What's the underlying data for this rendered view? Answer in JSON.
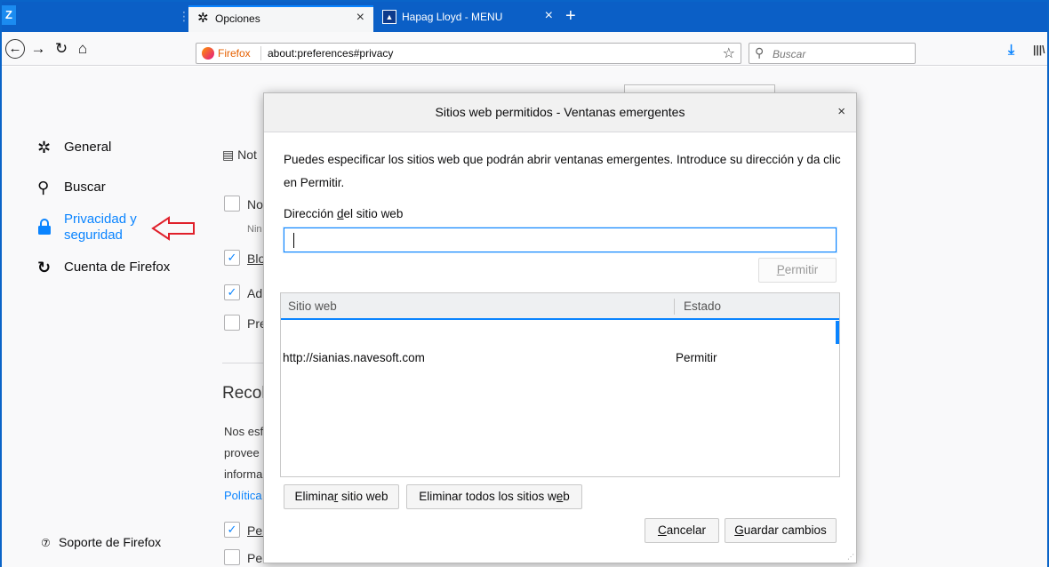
{
  "browser": {
    "tabs": [
      {
        "title": "Opciones",
        "icon": "gear-icon",
        "active": true,
        "close": "×"
      },
      {
        "title": "Hapag Lloyd - MENU",
        "icon": "hapag-lloyd-favicon",
        "active": false,
        "close": "×"
      }
    ],
    "new_tab": "+",
    "app_badge": "Z",
    "url_identity": "Firefox",
    "url": "about:preferences#privacy",
    "search_placeholder": "Buscar"
  },
  "sidebar": {
    "items": [
      {
        "label": "General",
        "icon": "gear-icon"
      },
      {
        "label": "Buscar",
        "icon": "search-icon"
      },
      {
        "label": "Privacidad y seguridad",
        "icon": "lock-icon",
        "selected": true
      },
      {
        "label": "Cuenta de Firefox",
        "icon": "sync-icon"
      }
    ],
    "support": "Soporte de Firefox"
  },
  "background": {
    "notif_prefix": "Not",
    "rows": [
      "No",
      "Nin",
      "Blo",
      "Ad",
      "Pre"
    ],
    "heading": "Recol",
    "para": [
      "Nos esf",
      "provee",
      "informa",
      "Política"
    ],
    "bottom_rows": [
      "Per",
      "Per"
    ]
  },
  "dialog": {
    "title": "Sitios web permitidos - Ventanas emergentes",
    "close": "×",
    "description": "Puedes especificar los sitios web que podrán abrir ventanas emergentes. Introduce su dirección y da clic en Permitir.",
    "address_label_pre": "Dirección ",
    "address_label_ul": "d",
    "address_label_post": "el sitio web",
    "address_value": "",
    "permit_button_ul": "P",
    "permit_button_rest": "ermitir",
    "table": {
      "headers": [
        "Sitio web",
        "Estado"
      ],
      "rows": [
        {
          "site": "http://sianias.navesoft.com",
          "status": "Permitir"
        }
      ]
    },
    "remove_site_pre": "Elimina",
    "remove_site_ul": "r",
    "remove_site_post": " sitio web",
    "remove_all_pre": "Eliminar todos los sitios w",
    "remove_all_ul": "e",
    "remove_all_post": "b",
    "cancel_ul": "C",
    "cancel_rest": "ancelar",
    "save_ul": "G",
    "save_rest": "uardar cambios"
  },
  "colors": {
    "tabbar": "#0b5fc6",
    "accent": "#0a84ff",
    "arrow": "#e0202a"
  }
}
